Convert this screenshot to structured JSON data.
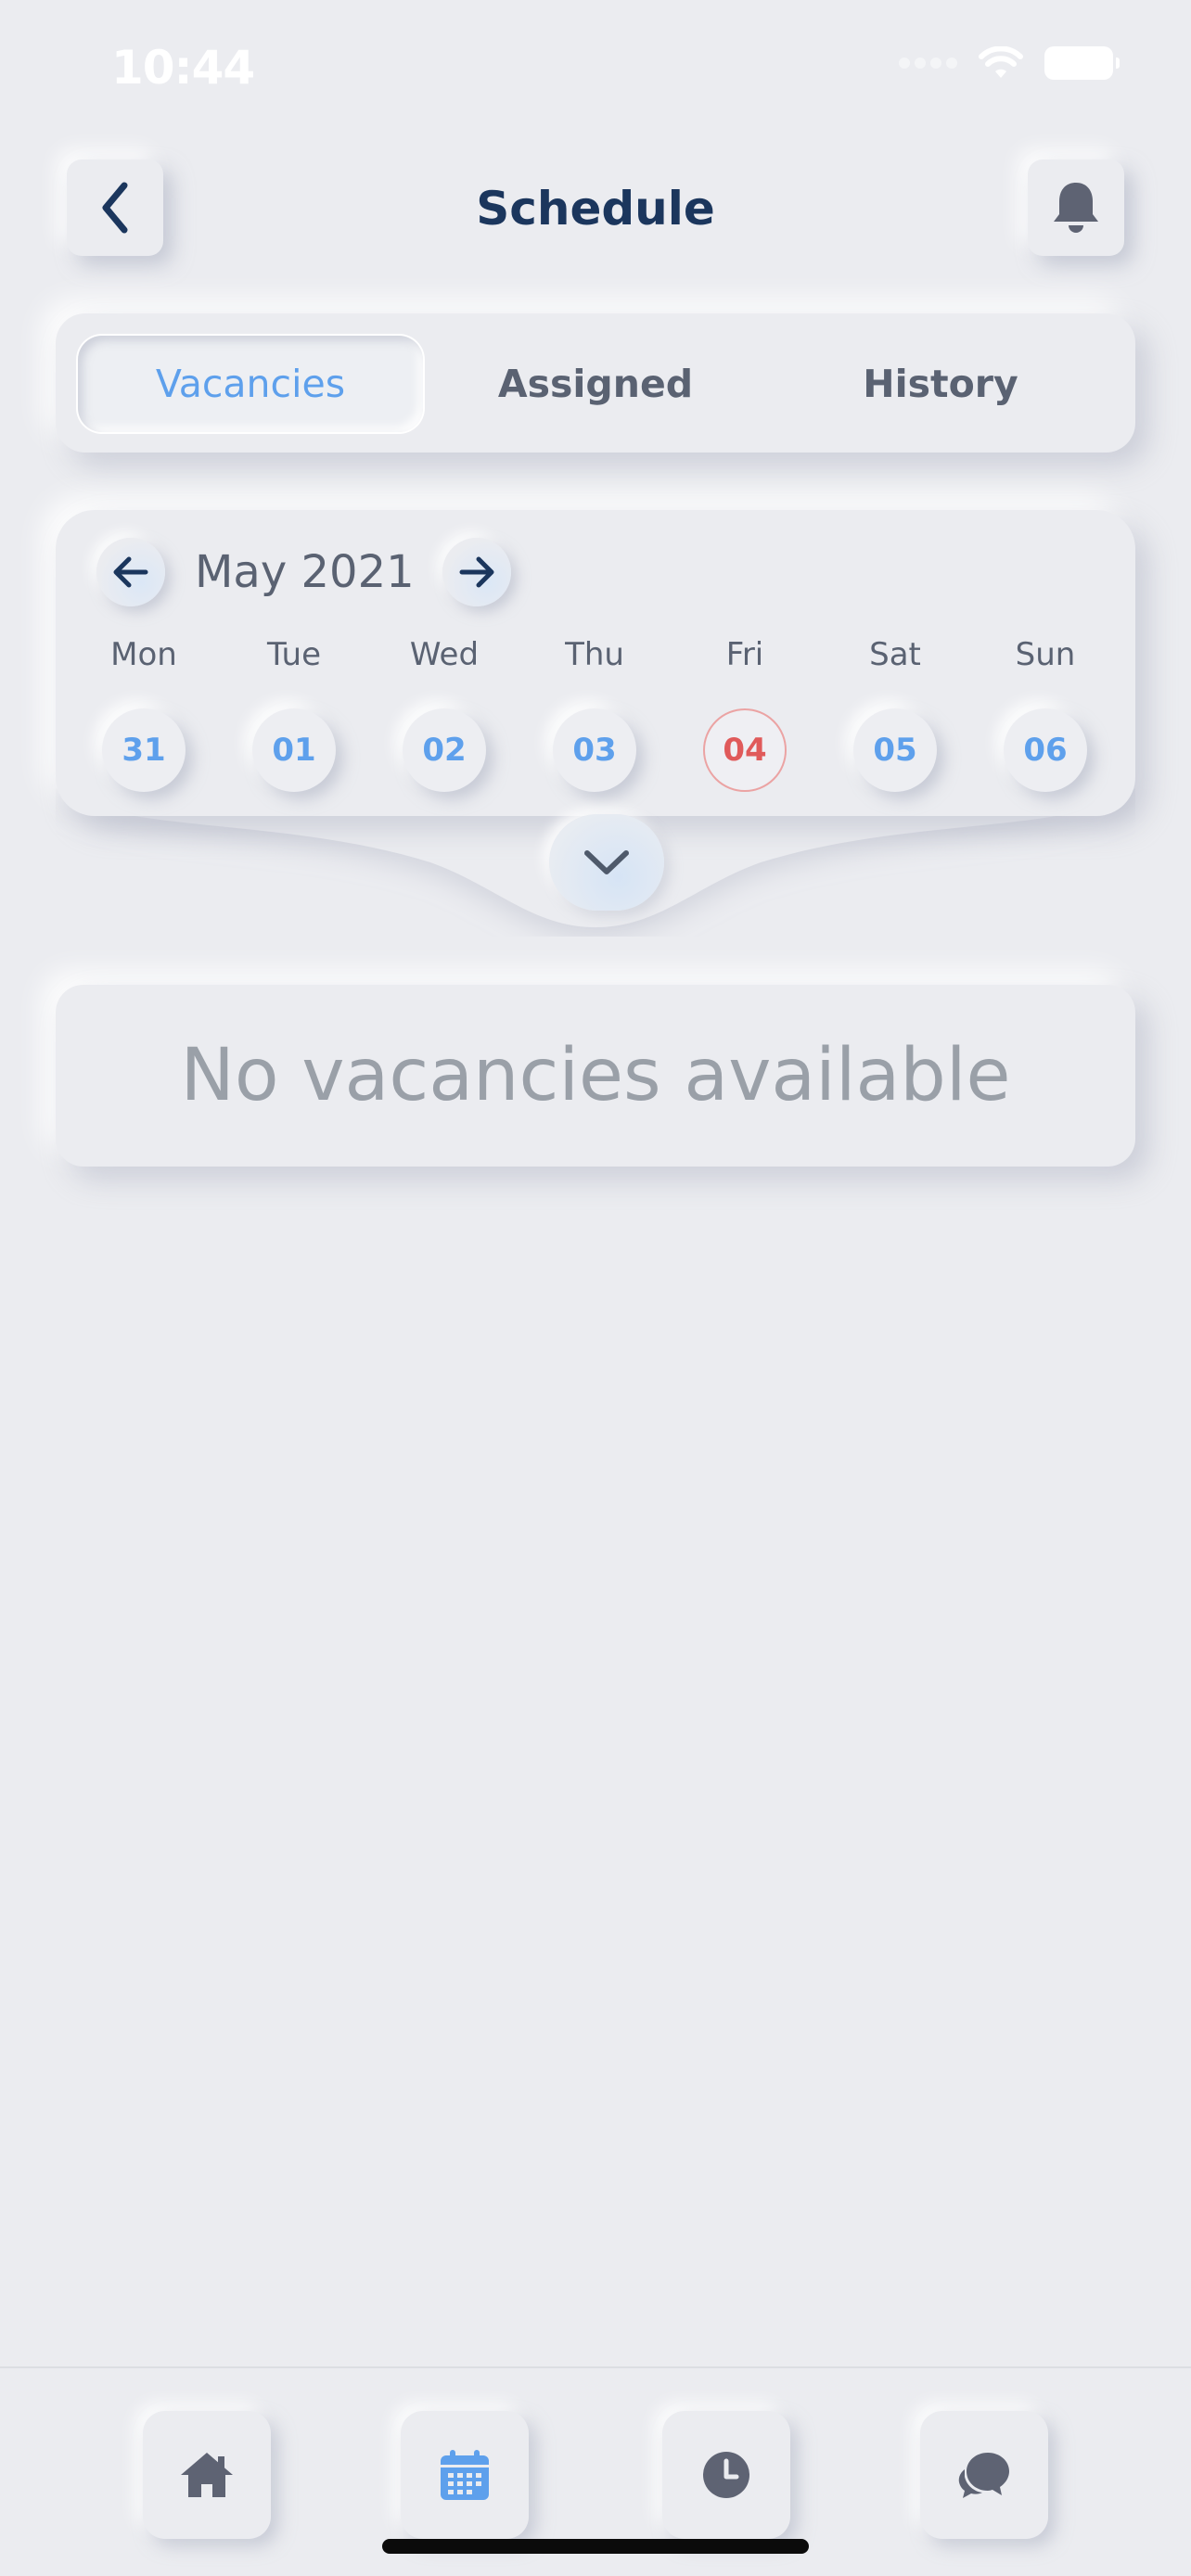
{
  "status_bar": {
    "time": "10:44"
  },
  "header": {
    "title": "Schedule",
    "back_icon": "chevron-left-icon",
    "notification_icon": "bell-icon"
  },
  "tabs": [
    {
      "label": "Vacancies",
      "active": true
    },
    {
      "label": "Assigned",
      "active": false
    },
    {
      "label": "History",
      "active": false
    }
  ],
  "calendar": {
    "month_label": "May 2021",
    "prev_icon": "arrow-left-icon",
    "next_icon": "arrow-right-icon",
    "days": [
      {
        "name": "Mon",
        "date": "31"
      },
      {
        "name": "Tue",
        "date": "01"
      },
      {
        "name": "Wed",
        "date": "02"
      },
      {
        "name": "Thu",
        "date": "03"
      },
      {
        "name": "Fri",
        "date": "04",
        "today": true
      },
      {
        "name": "Sat",
        "date": "05"
      },
      {
        "name": "Sun",
        "date": "06"
      }
    ],
    "expand_icon": "chevron-down-icon"
  },
  "content": {
    "empty_message": "No vacancies available"
  },
  "bottom_nav": [
    {
      "icon": "home-icon",
      "active": false
    },
    {
      "icon": "calendar-icon",
      "active": true
    },
    {
      "icon": "clock-icon",
      "active": false
    },
    {
      "icon": "chat-icon",
      "active": false
    }
  ],
  "colors": {
    "background": "#ebecf0",
    "accent": "#5ea0ec",
    "today": "#e05a5a",
    "title": "#1b365d",
    "muted_text": "#5a6272"
  }
}
